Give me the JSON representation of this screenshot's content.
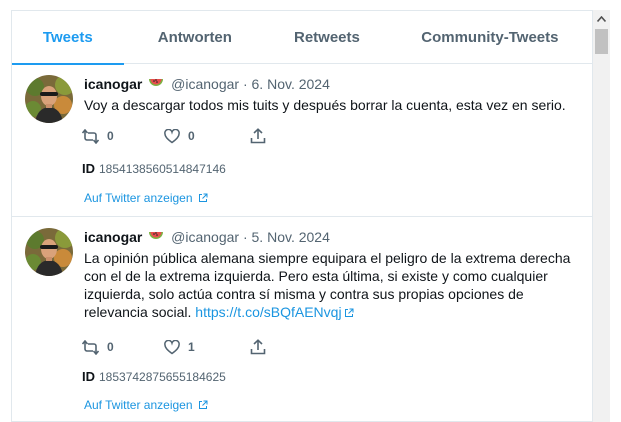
{
  "tabs": [
    {
      "label": "Tweets",
      "active": true
    },
    {
      "label": "Antworten",
      "active": false
    },
    {
      "label": "Retweets",
      "active": false
    },
    {
      "label": "Community-Tweets",
      "active": false
    }
  ],
  "colors": {
    "accent": "#1d9bf0",
    "link": "#1b95e0",
    "muted": "#536471",
    "border": "#e1e8ed"
  },
  "tweets": [
    {
      "name": "icanogar",
      "name_emoji_icon": "watermelon-icon",
      "handle": "@icanogar",
      "separator": "·",
      "date": "6. Nov. 2024",
      "text": "Voy a descargar todos mis tuits y después borrar la cuenta, esta vez en serio.",
      "replies": "0",
      "likes": "0",
      "id_label": "ID",
      "id": "1854138560514847146",
      "view_link": "Auf Twitter anzeigen"
    },
    {
      "name": "icanogar",
      "name_emoji_icon": "watermelon-icon",
      "handle": "@icanogar",
      "separator": "·",
      "date": "5. Nov. 2024",
      "text": "La opinión pública alemana siempre equipara el peligro de la extrema derecha con el de la extrema izquierda. Pero esta última, si existe y como cualquier izquierda, solo actúa contra sí misma y contra sus propias opciones de relevancia social.",
      "text_link": "https://t.co/sBQfAENvqj",
      "replies": "0",
      "likes": "1",
      "id_label": "ID",
      "id": "1853742875655184625",
      "view_link": "Auf Twitter anzeigen"
    }
  ]
}
